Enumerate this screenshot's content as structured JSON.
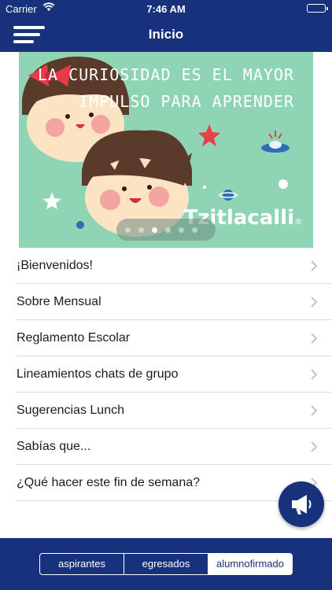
{
  "status": {
    "carrier": "Carrier",
    "time": "7:46 AM"
  },
  "nav": {
    "title": "Inicio"
  },
  "banner": {
    "headline_line1": "LA CURIOSIDAD ES EL MAYOR",
    "headline_line2": "IMPULSO PARA APRENDER",
    "brand": "Tzitlacalli",
    "brand_mark": "®",
    "page_count": 6,
    "active_page": 3
  },
  "menu": [
    {
      "label": "¡Bienvenidos!"
    },
    {
      "label": "Sobre Mensual"
    },
    {
      "label": "Reglamento Escolar"
    },
    {
      "label": "Lineamientos chats de grupo"
    },
    {
      "label": "Sugerencias Lunch"
    },
    {
      "label": "Sabías que..."
    },
    {
      "label": "¿Qué hacer este fin de semana?"
    }
  ],
  "segments": [
    {
      "label": "aspirantes",
      "selected": false
    },
    {
      "label": "egresados",
      "selected": false
    },
    {
      "label": "alumnofirmado",
      "selected": true
    }
  ],
  "colors": {
    "primary": "#17317c",
    "banner_bg": "#8fd4b4",
    "chevron": "#c4c4c8"
  },
  "icons": {
    "menu": "hamburger-icon",
    "fab": "megaphone-icon",
    "row": "chevron-right-icon"
  }
}
